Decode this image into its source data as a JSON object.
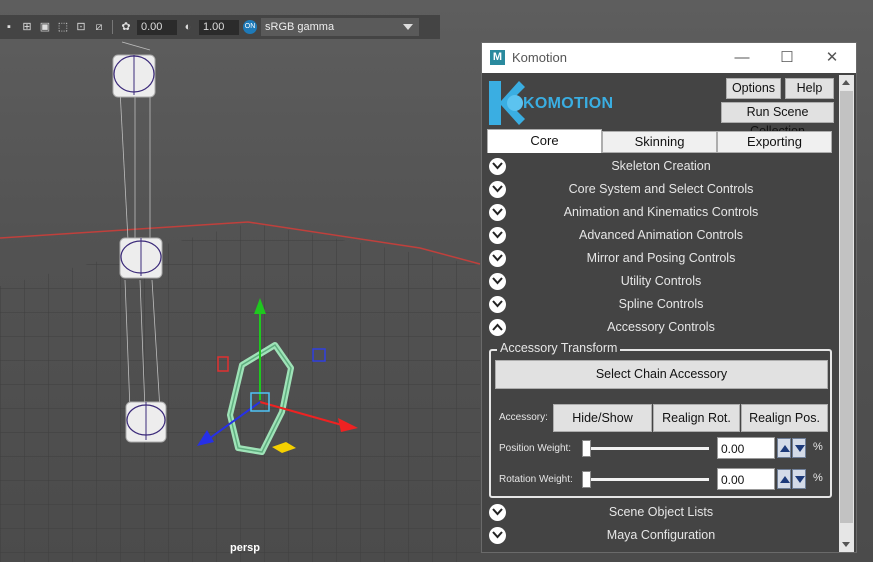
{
  "toolbar": {
    "exposure_value": "0.00",
    "gamma_value": "1.00",
    "colorspace_label": "sRGB gamma",
    "on_badge": "ON"
  },
  "viewport": {
    "camera_label": "persp"
  },
  "window": {
    "app_icon": "M",
    "title": "Komotion",
    "controls": {
      "minimize": "—",
      "maximize": "☐",
      "close": "✕"
    }
  },
  "header": {
    "logo_text": "KOMOTION",
    "options_label": "Options",
    "help_label": "Help",
    "run_scene_label": "Run Scene Collection"
  },
  "tabs": [
    {
      "label": "Core",
      "active": true
    },
    {
      "label": "Skinning",
      "active": false
    },
    {
      "label": "Exporting",
      "active": false
    }
  ],
  "sections": [
    {
      "label": "Skeleton Creation",
      "expanded": false
    },
    {
      "label": "Core System and Select Controls",
      "expanded": false
    },
    {
      "label": "Animation and Kinematics Controls",
      "expanded": false
    },
    {
      "label": "Advanced Animation Controls",
      "expanded": false
    },
    {
      "label": "Mirror and Posing Controls",
      "expanded": false
    },
    {
      "label": "Utility Controls",
      "expanded": false
    },
    {
      "label": "Spline Controls",
      "expanded": false
    },
    {
      "label": "Accessory Controls",
      "expanded": true
    }
  ],
  "accessory": {
    "group_title": "Accessory Transform",
    "select_chain_label": "Select Chain Accessory",
    "accessory_label": "Accessory:",
    "hide_show_label": "Hide/Show",
    "realign_rot_label": "Realign Rot.",
    "realign_pos_label": "Realign Pos.",
    "position_weight_label": "Position Weight:",
    "position_weight_value": "0.00",
    "position_weight_level": 0.0,
    "rotation_weight_label": "Rotation Weight:",
    "rotation_weight_value": "0.00",
    "rotation_weight_level": 0.0,
    "percent": "%"
  },
  "footer_sections": [
    {
      "label": "Scene Object Lists",
      "expanded": false
    },
    {
      "label": "Maya Configuration",
      "expanded": false
    }
  ],
  "colors": {
    "logo_blue": "#3aaee2",
    "grid_red": "#c0403c",
    "control_green": "#9fe3b8"
  }
}
